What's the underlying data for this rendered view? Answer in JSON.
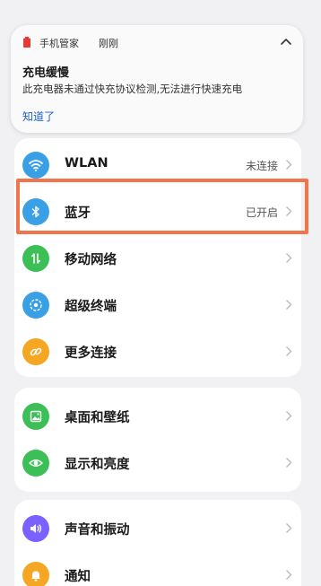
{
  "notification": {
    "app_name": "手机管家",
    "time": "刚刚",
    "title": "充电缓慢",
    "body": "此充电器未通过快充协议检测,无法进行快速充电",
    "action": "知道了"
  },
  "groups": [
    {
      "items": [
        {
          "label": "WLAN",
          "value": "未连接",
          "icon": "wifi-icon",
          "color": "#3aa0e6"
        },
        {
          "label": "蓝牙",
          "value": "已开启",
          "icon": "bluetooth-icon",
          "color": "#3aa0e6",
          "highlighted": true
        },
        {
          "label": "移动网络",
          "value": "",
          "icon": "mobile-network-icon",
          "color": "#3bbf56"
        },
        {
          "label": "超级终端",
          "value": "",
          "icon": "super-device-icon",
          "color": "#3aa0e6"
        },
        {
          "label": "更多连接",
          "value": "",
          "icon": "link-icon",
          "color": "#f5a623"
        }
      ]
    },
    {
      "items": [
        {
          "label": "桌面和壁纸",
          "value": "",
          "icon": "wallpaper-icon",
          "color": "#3bbf56"
        },
        {
          "label": "显示和亮度",
          "value": "",
          "icon": "display-eye-icon",
          "color": "#3bbf56"
        }
      ]
    },
    {
      "items": [
        {
          "label": "声音和振动",
          "value": "",
          "icon": "sound-icon",
          "color": "#7b61ff"
        },
        {
          "label": "通知",
          "value": "",
          "icon": "bell-icon",
          "color": "#f5a623"
        }
      ]
    }
  ],
  "colors": {
    "highlight": "#f2744a",
    "link": "#1e5fc8",
    "background": "#f1f1f3"
  }
}
